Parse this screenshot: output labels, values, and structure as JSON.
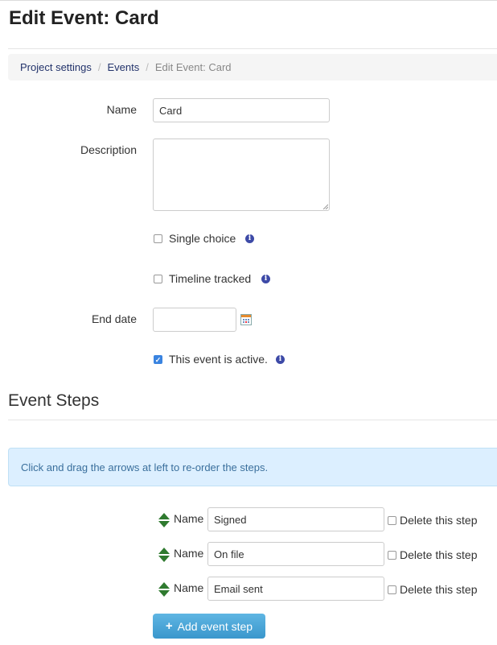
{
  "page": {
    "title": "Edit Event: Card"
  },
  "breadcrumb": {
    "items": [
      "Project settings",
      "Events"
    ],
    "current": "Edit Event: Card",
    "separator": "/"
  },
  "form": {
    "name_label": "Name",
    "name_value": "Card",
    "description_label": "Description",
    "description_value": "",
    "single_choice_label": "Single choice",
    "single_choice_checked": false,
    "timeline_label": "Timeline tracked",
    "timeline_checked": false,
    "end_date_label": "End date",
    "end_date_value": "",
    "active_label": "This event is active.",
    "active_checked": true,
    "info_glyph": "i"
  },
  "steps_section": {
    "title": "Event Steps",
    "hint": "Click and drag the arrows at left to re-order the steps.",
    "name_label": "Name",
    "delete_label": "Delete this step",
    "steps": [
      {
        "name": "Signed",
        "delete_checked": false
      },
      {
        "name": "On file",
        "delete_checked": false
      },
      {
        "name": "Email sent",
        "delete_checked": false
      }
    ],
    "add_button_label": "Add event step",
    "add_button_icon": "+"
  },
  "colors": {
    "link": "#23336b",
    "info": "#3d4aa7",
    "drag_arrow": "#2f7a2f",
    "button": "#3a97cc",
    "alert_bg": "#dcefff"
  }
}
